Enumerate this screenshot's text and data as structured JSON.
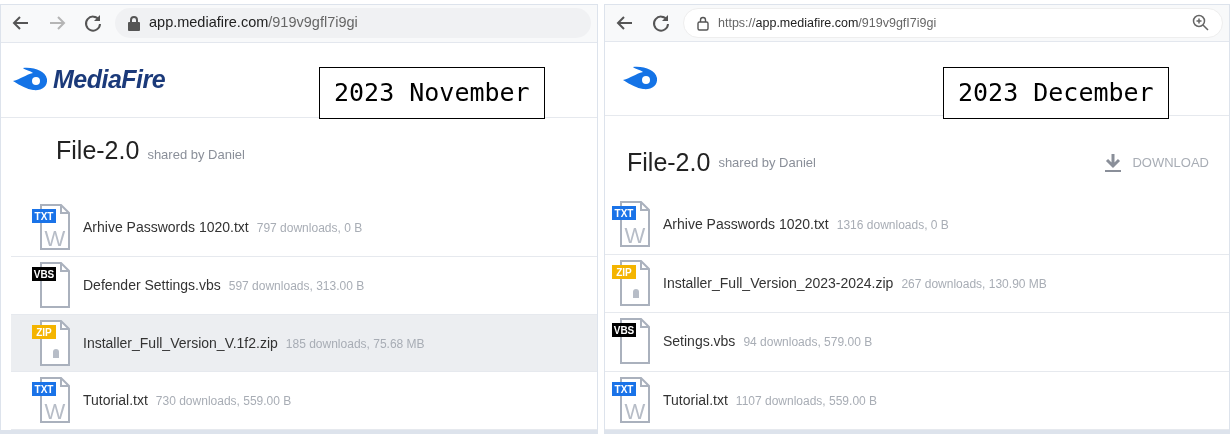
{
  "panels": [
    {
      "browser": {
        "buttons": [
          {
            "kind": "back",
            "disabled": false
          },
          {
            "kind": "forward",
            "disabled": true
          },
          {
            "kind": "reload",
            "disabled": false
          }
        ],
        "url": {
          "host": "app.mediafire.com",
          "path": "/919v9gfl7i9gi"
        },
        "zoom_icon": false
      },
      "logo": {
        "wordmark": "MediaFire"
      },
      "label": "2023 November",
      "title": "File-2.0",
      "shared_by": "shared by Daniel",
      "files": [
        {
          "kind": "txt",
          "badge": "TXT",
          "glyph": "W",
          "name": "Arhive Passwords 1020.txt",
          "meta": "797 downloads, 0 B",
          "highlighted": false
        },
        {
          "kind": "vbs",
          "badge": "VBS",
          "name": "Defender Settings.vbs",
          "meta": "597 downloads, 313.00 B",
          "highlighted": false
        },
        {
          "kind": "zip",
          "badge": "ZIP",
          "name": "Installer_Full_Version_V.1f2.zip",
          "meta": "185 downloads, 75.68 MB",
          "highlighted": true
        },
        {
          "kind": "txt",
          "badge": "TXT",
          "glyph": "W",
          "name": "Tutorial.txt",
          "meta": "730 downloads, 559.00 B",
          "highlighted": false
        }
      ]
    },
    {
      "browser": {
        "buttons": [
          {
            "kind": "back",
            "disabled": false
          },
          {
            "kind": "reload",
            "disabled": false
          }
        ],
        "url": {
          "scheme": "https://",
          "host": "app.mediafire.com",
          "path": "/919v9gfI7i9gi"
        },
        "zoom_icon": true
      },
      "label": "2023 December",
      "title": "File-2.0",
      "shared_by": "shared by Daniel",
      "download": "DOWNLOAD",
      "files": [
        {
          "kind": "txt",
          "badge": "TXT",
          "glyph": "W",
          "name": "Arhive Passwords 1020.txt",
          "meta": "1316 downloads, 0 B",
          "highlighted": false
        },
        {
          "kind": "zip",
          "badge": "ZIP",
          "name": "Installer_Full_Version_2023-2024.zip",
          "meta": "267 downloads, 130.90 MB",
          "highlighted": false
        },
        {
          "kind": "vbs",
          "badge": "VBS",
          "name": "Setings.vbs",
          "meta": "94 downloads, 579.00 B",
          "highlighted": false
        },
        {
          "kind": "txt",
          "badge": "TXT",
          "glyph": "W",
          "name": "Tutorial.txt",
          "meta": "1107 downloads, 559.00 B",
          "highlighted": false
        }
      ]
    }
  ]
}
